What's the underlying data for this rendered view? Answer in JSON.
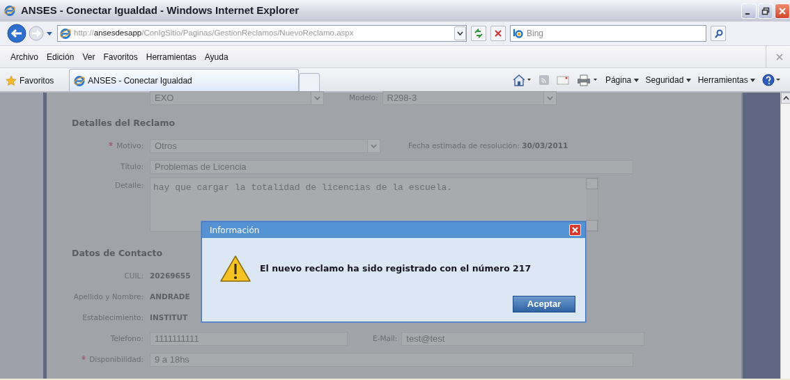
{
  "window": {
    "title": "ANSES - Conectar Igualdad - Windows Internet Explorer"
  },
  "address_bar": {
    "url_parts": [
      {
        "text": "http://",
        "kind": "dim"
      },
      {
        "text": "ansesdesapp",
        "kind": "host"
      },
      {
        "text": "/ConIgSitio/Paginas/GestionReclamos/NuevoReclamo.aspx",
        "kind": "dim"
      }
    ]
  },
  "search": {
    "placeholder": "Bing"
  },
  "menu": [
    "Archivo",
    "Edición",
    "Ver",
    "Favoritos",
    "Herramientas",
    "Ayuda"
  ],
  "favorites_bar": {
    "label": "Favoritos",
    "tab": "ANSES - Conectar Igualdad"
  },
  "command_bar": [
    "Página",
    "Seguridad",
    "Herramientas"
  ],
  "form": {
    "top_row": [
      {
        "kind": "select",
        "value": "EXO"
      },
      {
        "kind": "select",
        "label": "Modelo:",
        "value": "R298-3"
      }
    ],
    "sections": [
      {
        "title": "Detalles del Reclamo",
        "rows": [
          [
            {
              "kind": "select",
              "label": "Motivo:",
              "required": true,
              "value": "Otros"
            },
            {
              "kind": "info",
              "label": "Fecha estimada de resolución:",
              "value": "30/03/2011"
            }
          ],
          [
            {
              "kind": "input",
              "label": "Título:",
              "value": "Problemas de Licencia"
            }
          ],
          [
            {
              "kind": "textarea",
              "label": "Detalle:",
              "value": "hay que cargar la totalidad de licencias de la escuela."
            }
          ]
        ]
      },
      {
        "title": "Datos de Contacto",
        "rows": [
          [
            {
              "kind": "static",
              "label": "CUIL:",
              "value": "20269655"
            }
          ],
          [
            {
              "kind": "static",
              "label": "Apellido y Nombre:",
              "value": "ANDRADE"
            }
          ],
          [
            {
              "kind": "static",
              "label": "Establecimiento:",
              "value": "INSTITUT"
            }
          ],
          [
            {
              "kind": "input",
              "label": "Telefono:",
              "value": "1111111111"
            },
            {
              "kind": "input",
              "label": "E-Mail:",
              "value": "test@test"
            }
          ],
          [
            {
              "kind": "input",
              "label": "Disponibilidad:",
              "required": true,
              "value": "9 a 18hs"
            }
          ]
        ]
      }
    ]
  },
  "dialog": {
    "title": "Información",
    "message": "El nuevo reclamo ha sido registrado con el número 217",
    "button": "Aceptar"
  }
}
